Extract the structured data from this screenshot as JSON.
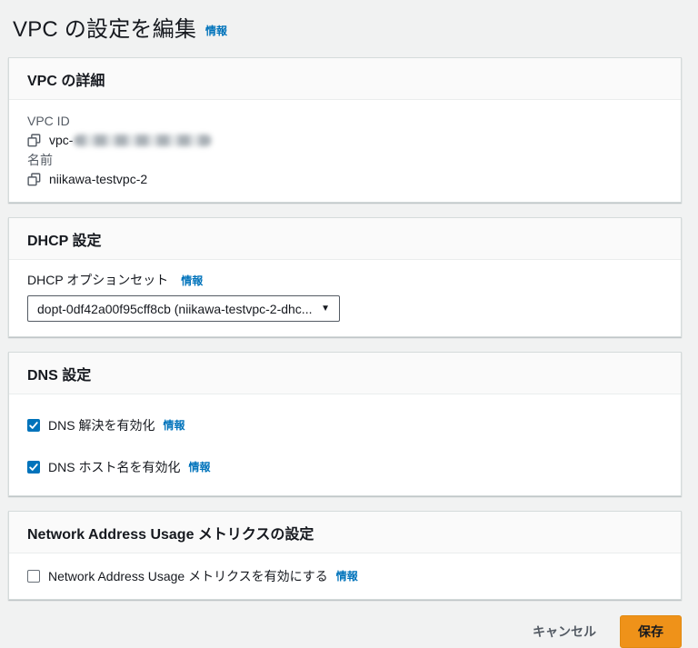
{
  "page": {
    "title": "VPC の設定を編集",
    "info": "情報"
  },
  "colors": {
    "link_blue": "#0073bb",
    "checkbox_checked_blue": "#0073bb",
    "save_button_orange": "#ef9219",
    "page_background": "#f1f2f2"
  },
  "vpc_details": {
    "heading": "VPC の詳細",
    "vpc_id_label": "VPC ID",
    "vpc_id_prefix": "vpc-",
    "name_label": "名前",
    "name_value": "niikawa-testvpc-2"
  },
  "dhcp": {
    "heading": "DHCP 設定",
    "option_set_label": "DHCP オプションセット",
    "info": "情報",
    "selected_option": "dopt-0df42a00f95cff8cb (niikawa-testvpc-2-dhc..."
  },
  "dns": {
    "heading": "DNS 設定",
    "options": [
      {
        "label": "DNS 解決を有効化",
        "info": "情報",
        "checked": true
      },
      {
        "label": "DNS ホスト名を有効化",
        "info": "情報",
        "checked": true
      }
    ]
  },
  "nau": {
    "heading": "Network Address Usage メトリクスの設定",
    "option": {
      "label": "Network Address Usage メトリクスを有効にする",
      "info": "情報",
      "checked": false
    }
  },
  "footer": {
    "cancel": "キャンセル",
    "save": "保存"
  }
}
